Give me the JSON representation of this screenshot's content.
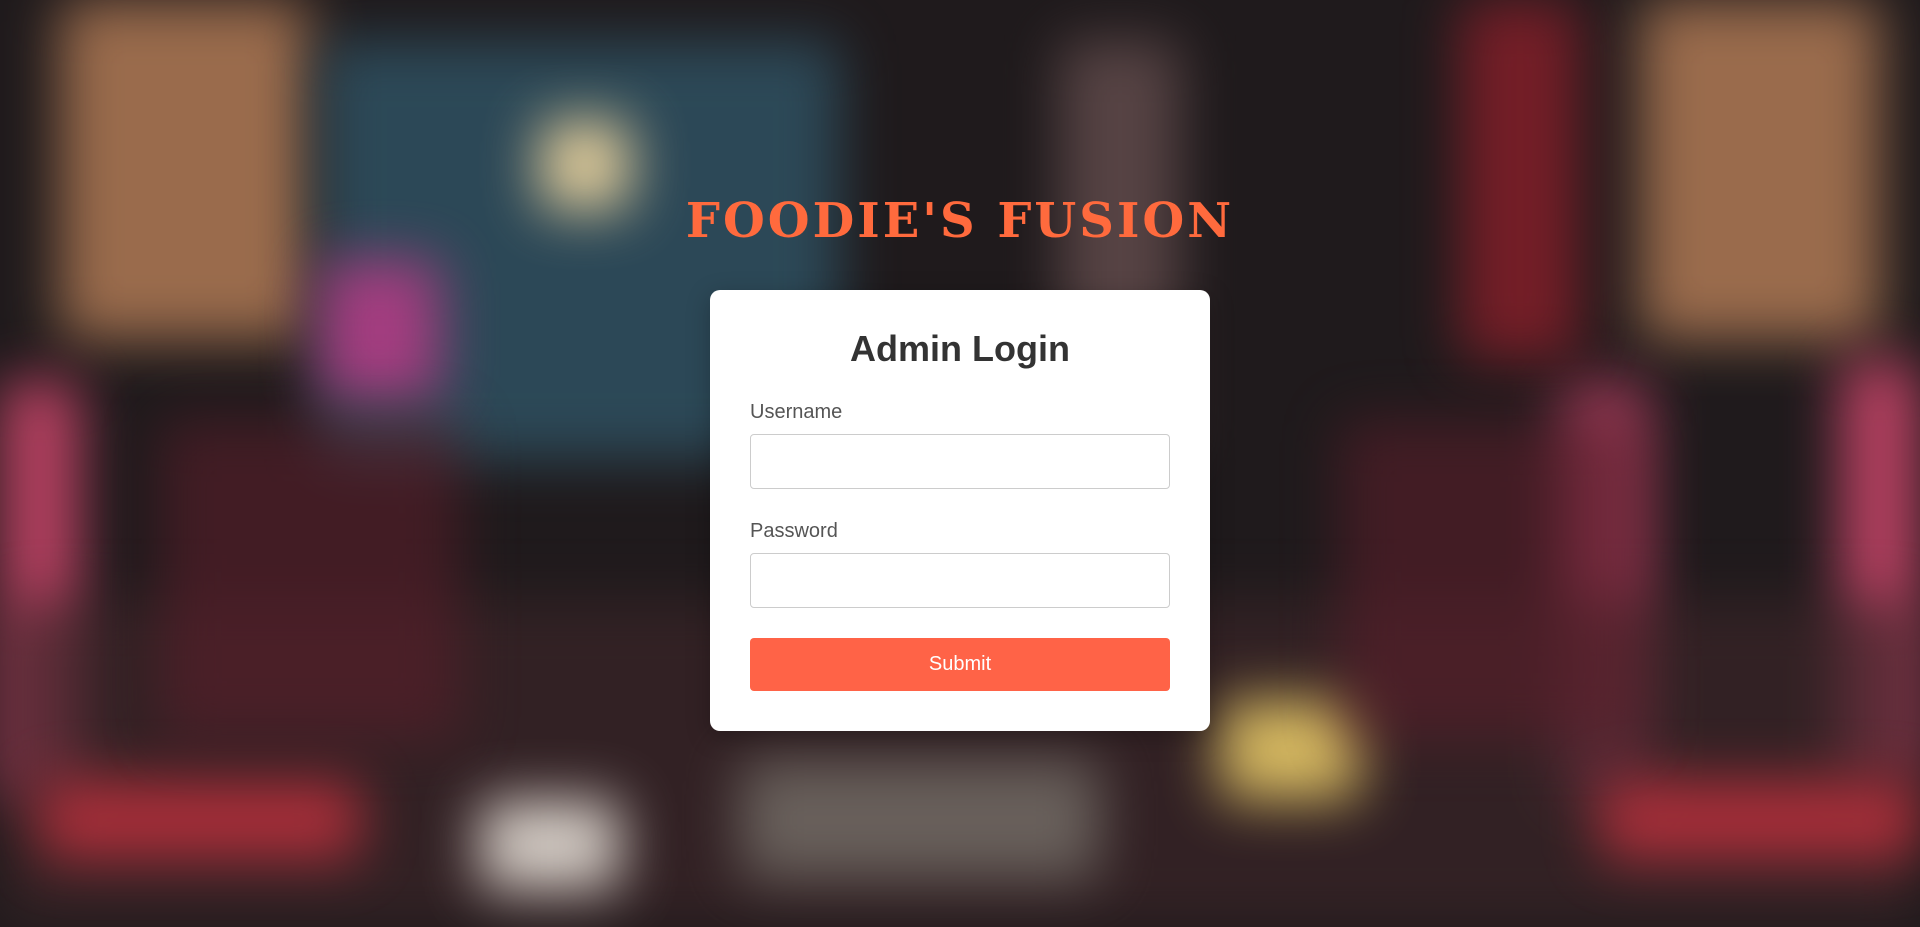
{
  "brand": {
    "title": "FOODIE'S FUSION",
    "color": "#ff6a3d"
  },
  "login": {
    "heading": "Admin Login",
    "username_label": "Username",
    "username_value": "",
    "password_label": "Password",
    "password_value": "",
    "submit_label": "Submit",
    "accent_color": "#ff6347"
  }
}
